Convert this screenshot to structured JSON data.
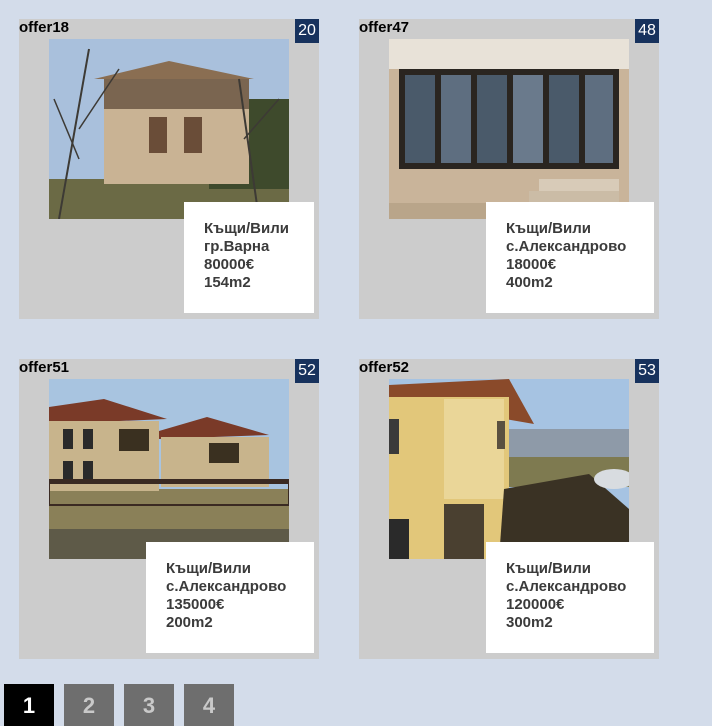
{
  "offers": [
    {
      "id": "offer18",
      "badge": "20",
      "type": "Къщи/Вили",
      "location": "гр.Варна",
      "price": "80000€",
      "area": "154m2"
    },
    {
      "id": "offer47",
      "badge": "48",
      "type": "Къщи/Вили",
      "location": "с.Александрово",
      "price": "18000€",
      "area": "400m2"
    },
    {
      "id": "offer51",
      "badge": "52",
      "type": "Къщи/Вили",
      "location": "с.Александрово",
      "price": "135000€",
      "area": "200m2"
    },
    {
      "id": "offer52",
      "badge": "53",
      "type": "Къщи/Вили",
      "location": "с.Александрово",
      "price": "120000€",
      "area": "300m2"
    }
  ],
  "pagination": {
    "pages": [
      "1",
      "2",
      "3",
      "4"
    ],
    "current": "1"
  },
  "colors": {
    "page_bg": "#d3dcea",
    "card_bg": "#cccccc",
    "badge_bg": "#17325d",
    "active_page": "#000000",
    "page_button": "#6e6e6e"
  }
}
